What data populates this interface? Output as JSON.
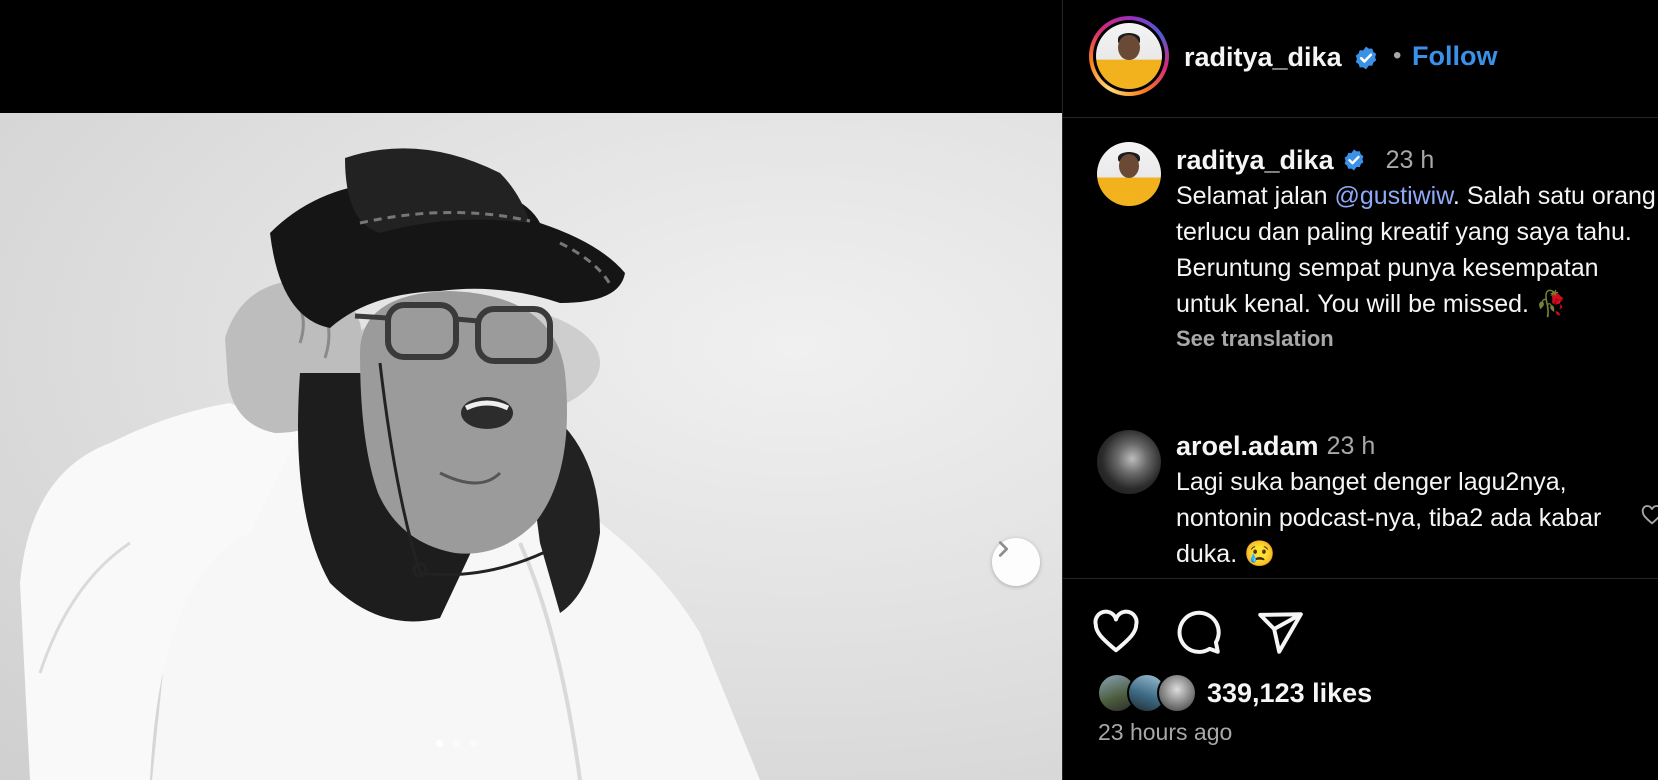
{
  "header": {
    "username": "raditya_dika",
    "separator": "•",
    "follow_label": "Follow"
  },
  "caption": {
    "username": "raditya_dika",
    "time": "23 h",
    "text_before_mention": "Selamat jalan ",
    "mention": "@gustiwiw",
    "text_after_mention": ". Salah satu orang terlucu dan paling kreatif yang saya tahu. Beruntung sempat punya kesempatan untuk kenal. You will be missed. 🥀",
    "see_translation": "See translation"
  },
  "comments": [
    {
      "username": "aroel.adam",
      "time": "23 h",
      "text": "Lagi suka banget denger lagu2nya, nontonin podcast-nya, tiba2 ada kabar duka. 😢"
    }
  ],
  "likes": {
    "count_label": "339,123 likes"
  },
  "timestamp": "23 hours ago",
  "carousel": {
    "total_slides": 3,
    "active_index": 0
  },
  "colors": {
    "background": "#000000",
    "accent_blue": "#3b90e8",
    "mention": "#8ea9f5",
    "muted_text": "#a8a8a8",
    "divider": "#262626"
  },
  "icons": {
    "verified": "verified-badge-icon",
    "next": "chevron-right-icon",
    "like": "heart-icon",
    "comment": "comment-bubble-icon",
    "share": "paper-plane-icon"
  }
}
